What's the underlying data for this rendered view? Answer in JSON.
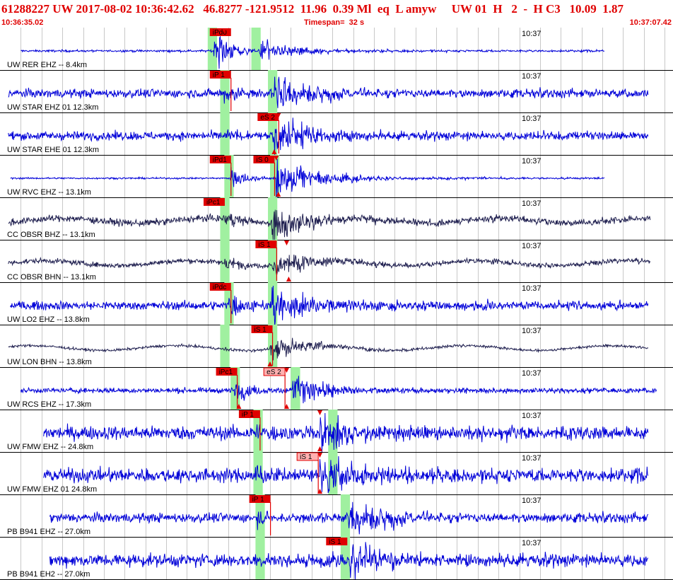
{
  "header": {
    "title": "61288227 UW 2017-08-02 10:36:42.62   46.8277 -121.9512  11.96  0.39 Ml  eq  L amyw     UW 01  H   2  -  H C3   10.09  1.87",
    "start_time": "10:36:35.02",
    "timespan": "Timespan=  32 s",
    "end_time": "10:37:07.42"
  },
  "time_label": "10:37",
  "colors": {
    "header": "#e00000",
    "trace_blue": "#0000d8",
    "trace_dark": "#202050",
    "pick_fill": "#e00000",
    "pick_faint": "#ffb0b0",
    "window_green": "#a0f0a0",
    "grid": "#c8c8c8",
    "divider": "#000000"
  },
  "traces": [
    {
      "label": "UW RER EHZ -- 8.4km",
      "color": "blue",
      "tmin": 1.0,
      "tmax": 29.1,
      "noise": 0.05,
      "p_time": 10.3,
      "p_amp": 0.95,
      "s_time": 12.5,
      "s_amp": 0.45,
      "green": [
        {
          "t": 10.0,
          "w": 0.45
        },
        {
          "t": 12.1,
          "w": 0.45
        }
      ],
      "picks": [
        {
          "label": "iPd0",
          "t": 10.1,
          "style": "solid",
          "line": false
        }
      ],
      "markers": [
        {
          "t": 10.8,
          "pos": "top"
        }
      ]
    },
    {
      "label": "UW STAR EHZ 01 12.3km",
      "color": "blue",
      "tmin": 0.4,
      "tmax": 31.2,
      "noise": 0.2,
      "p_time": 10.8,
      "p_amp": 0.5,
      "s_time": 13.2,
      "s_amp": 0.9,
      "green": [
        {
          "t": 10.6,
          "w": 0.45
        },
        {
          "t": 12.9,
          "w": 0.45
        }
      ],
      "picks": [
        {
          "label": "iP 1",
          "t": 10.1,
          "style": "solid",
          "line": true
        }
      ],
      "markers": []
    },
    {
      "label": "UW STAR EHE 01 12.3km",
      "color": "blue",
      "tmin": 0.4,
      "tmax": 31.2,
      "noise": 0.2,
      "p_time": 10.8,
      "p_amp": 0.3,
      "s_time": 13.2,
      "s_amp": 0.95,
      "green": [
        {
          "t": 10.6,
          "w": 0.45
        },
        {
          "t": 12.9,
          "w": 0.45
        }
      ],
      "picks": [
        {
          "label": "eS 2",
          "t": 12.4,
          "style": "solid",
          "line": true
        }
      ],
      "markers": [
        {
          "t": 13.4,
          "pos": "top"
        },
        {
          "t": 13.2,
          "pos": "bottom"
        }
      ]
    },
    {
      "label": "UW RVC EHZ -- 13.1km",
      "color": "blue",
      "tmin": 0.5,
      "tmax": 29.1,
      "noise": 0.04,
      "p_time": 11.1,
      "p_amp": 0.5,
      "s_time": 13.3,
      "s_amp": 0.95,
      "green": [
        {
          "t": 10.8,
          "w": 0.45
        },
        {
          "t": 13.0,
          "w": 0.45
        }
      ],
      "picks": [
        {
          "label": "iPd1",
          "t": 10.1,
          "style": "solid",
          "line": true
        },
        {
          "label": "iS 0",
          "t": 12.2,
          "style": "solid",
          "line": true
        }
      ],
      "markers": [
        {
          "t": 13.3,
          "pos": "top"
        },
        {
          "t": 13.4,
          "pos": "bottom"
        }
      ]
    },
    {
      "label": "CC OBSR BHZ -- 13.1km",
      "color": "dark",
      "tmin": 0.4,
      "tmax": 31.3,
      "noise": 0.16,
      "p_time": 10.8,
      "p_amp": 0.45,
      "s_time": 13.1,
      "s_amp": 0.75,
      "green": [
        {
          "t": 10.6,
          "w": 0.45
        },
        {
          "t": 12.9,
          "w": 0.45
        }
      ],
      "picks": [
        {
          "label": "iPc1",
          "t": 9.8,
          "style": "solid",
          "line": false
        }
      ],
      "markers": []
    },
    {
      "label": "CC OBSR BHN -- 13.1km",
      "color": "dark",
      "tmin": 0.4,
      "tmax": 31.3,
      "noise": 0.12,
      "p_time": 10.8,
      "p_amp": 0.35,
      "s_time": 13.1,
      "s_amp": 0.65,
      "green": [
        {
          "t": 10.6,
          "w": 0.45
        },
        {
          "t": 12.9,
          "w": 0.45
        }
      ],
      "picks": [
        {
          "label": "iS 1",
          "t": 12.3,
          "style": "solid",
          "line": true
        }
      ],
      "markers": [
        {
          "t": 13.8,
          "pos": "top"
        },
        {
          "t": 13.9,
          "pos": "bottom"
        }
      ]
    },
    {
      "label": "UW LO2 EHZ -- 13.8km",
      "color": "blue",
      "tmin": 0.5,
      "tmax": 31.2,
      "noise": 0.2,
      "p_time": 11.0,
      "p_amp": 0.6,
      "s_time": 13.1,
      "s_amp": 0.95,
      "green": [
        {
          "t": 10.8,
          "w": 0.45
        },
        {
          "t": 12.9,
          "w": 0.45
        }
      ],
      "picks": [
        {
          "label": "iPdc",
          "t": 10.1,
          "style": "solid",
          "line": true
        }
      ],
      "markers": []
    },
    {
      "label": "UW LON BHN -- 13.8km",
      "color": "dark",
      "tmin": 0.4,
      "tmax": 31.2,
      "noise": 0.06,
      "p_time": 10.8,
      "p_amp": 0.1,
      "s_time": 13.0,
      "s_amp": 0.55,
      "green": [
        {
          "t": 10.6,
          "w": 0.45
        },
        {
          "t": 12.9,
          "w": 0.45
        }
      ],
      "picks": [
        {
          "label": "iS 1",
          "t": 12.1,
          "style": "solid",
          "line": true
        }
      ],
      "markers": [
        {
          "t": 13.0,
          "pos": "bottom"
        }
      ]
    },
    {
      "label": "UW RCS EHZ -- 17.3km",
      "color": "blue",
      "tmin": 1.0,
      "tmax": 31.6,
      "noise": 0.12,
      "p_time": 11.3,
      "p_amp": 0.55,
      "s_time": 14.1,
      "s_amp": 0.7,
      "green": [
        {
          "t": 11.1,
          "w": 0.45
        },
        {
          "t": 14.0,
          "w": 0.45
        }
      ],
      "picks": [
        {
          "label": "iPc1",
          "t": 10.4,
          "style": "solid",
          "line": true
        },
        {
          "label": "eS 2",
          "t": 12.7,
          "style": "faint",
          "line": true
        }
      ],
      "markers": [
        {
          "t": 11.5,
          "pos": "bottom"
        },
        {
          "t": 13.8,
          "pos": "bottom"
        },
        {
          "t": 13.8,
          "pos": "top"
        }
      ]
    },
    {
      "label": "UW FMW EHZ -- 24.8km",
      "color": "blue",
      "tmin": 2.1,
      "tmax": 31.2,
      "noise": 0.32,
      "p_time": 12.3,
      "p_amp": 0.5,
      "s_time": 15.4,
      "s_amp": 0.9,
      "green": [
        {
          "t": 12.2,
          "w": 0.45
        },
        {
          "t": 15.8,
          "w": 0.45
        }
      ],
      "picks": [
        {
          "label": "iP 1",
          "t": 11.5,
          "style": "solid",
          "line": true
        }
      ],
      "markers": [
        {
          "t": 15.4,
          "pos": "top"
        },
        {
          "t": 15.4,
          "pos": "bottom"
        }
      ]
    },
    {
      "label": "UW FMW EHZ 01 24.8km",
      "color": "blue",
      "tmin": 2.1,
      "tmax": 31.2,
      "noise": 0.32,
      "p_time": 12.3,
      "p_amp": 0.5,
      "s_time": 15.4,
      "s_amp": 0.9,
      "green": [
        {
          "t": 12.2,
          "w": 0.45
        },
        {
          "t": 15.8,
          "w": 0.45
        }
      ],
      "picks": [
        {
          "label": "iS 1",
          "t": 14.3,
          "style": "faint",
          "line": true
        }
      ],
      "markers": [
        {
          "t": 15.4,
          "pos": "top"
        },
        {
          "t": 15.4,
          "pos": "bottom"
        }
      ]
    },
    {
      "label": "PB B941 EHZ -- 27.0km",
      "color": "blue",
      "tmin": 2.4,
      "tmax": 31.2,
      "noise": 0.22,
      "p_time": 12.4,
      "p_amp": 0.3,
      "s_time": 16.8,
      "s_amp": 0.95,
      "green": [
        {
          "t": 12.3,
          "w": 0.45
        },
        {
          "t": 16.4,
          "w": 0.45
        }
      ],
      "picks": [
        {
          "label": "iP 1",
          "t": 12.0,
          "style": "solid",
          "line": true
        }
      ],
      "markers": []
    },
    {
      "label": "PB B941 EH2 -- 27.0km",
      "color": "blue",
      "tmin": 2.4,
      "tmax": 31.2,
      "noise": 0.3,
      "p_time": 12.4,
      "p_amp": 0.3,
      "s_time": 16.8,
      "s_amp": 0.95,
      "green": [
        {
          "t": 12.3,
          "w": 0.45
        },
        {
          "t": 16.4,
          "w": 0.45
        }
      ],
      "picks": [
        {
          "label": "iS 1",
          "t": 15.7,
          "style": "solid",
          "line": false
        }
      ],
      "markers": []
    }
  ]
}
